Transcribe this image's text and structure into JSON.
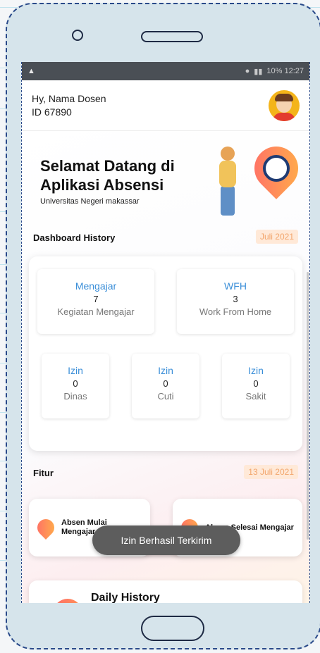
{
  "status": {
    "left_icon": "notification-icon",
    "right_text": "10% 12:27"
  },
  "header": {
    "greeting": "Hy, Nama Dosen",
    "id": "ID 67890"
  },
  "welcome": {
    "title": "Selamat Datang di Aplikasi Absensi",
    "university": "Universitas Negeri makassar"
  },
  "dashboard": {
    "title": "Dashboard History",
    "date": "Juli 2021",
    "top": [
      {
        "title": "Mengajar",
        "value": "7",
        "subtitle": "Kegiatan Mengajar"
      },
      {
        "title": "WFH",
        "value": "3",
        "subtitle": "Work From Home"
      }
    ],
    "bottom": [
      {
        "title": "Izin",
        "value": "0",
        "subtitle": "Dinas"
      },
      {
        "title": "Izin",
        "value": "0",
        "subtitle": "Cuti"
      },
      {
        "title": "Izin",
        "value": "0",
        "subtitle": "Sakit"
      }
    ]
  },
  "features": {
    "title": "Fitur",
    "date": "13 Juli 2021",
    "items": [
      {
        "label": "Absen Mulai Mengajar"
      },
      {
        "label": "Absen Selesai Mengajar"
      }
    ],
    "daily": "Daily History"
  },
  "toast": "Izin Berhasil Terkirim",
  "colors": {
    "accent": "#3a8ed8",
    "pin_start": "#ff6a6a",
    "pin_end": "#ffb347",
    "frame": "#2a4a8a"
  }
}
